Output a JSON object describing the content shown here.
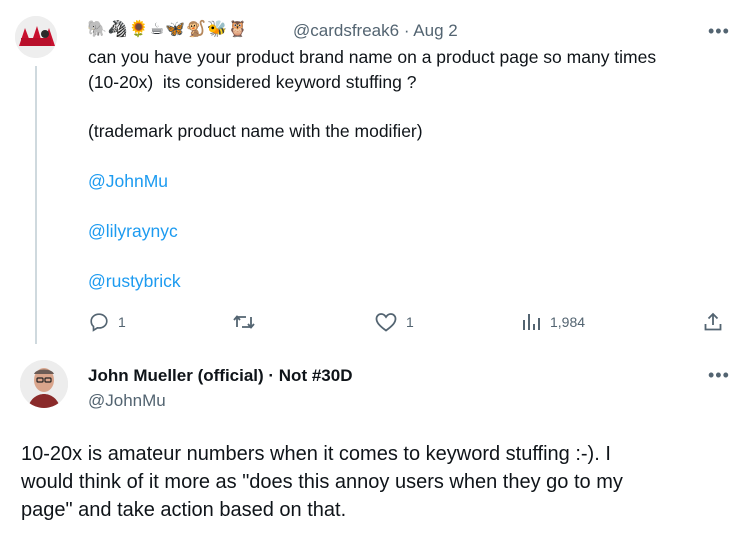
{
  "tweet1": {
    "emoji_names": [
      "elephant",
      "zebra",
      "sunflower",
      "coffee",
      "butterfly",
      "monkey",
      "bee",
      "owl"
    ],
    "handle": "@cardsfreak6",
    "separator": "·",
    "date": "Aug 2",
    "more": "•••",
    "lines": [
      "can you have your product brand name on a product page so many times",
      "(10-20x)  its considered keyword stuffing ?",
      "(trademark product name with the modifier)"
    ],
    "mentions": [
      "@JohnMu",
      "@lilyraynyc",
      "@rustybrick"
    ],
    "actions": {
      "reply_count": "1",
      "retweet_count": "",
      "like_count": "1",
      "views_count": "1,984"
    }
  },
  "tweet2": {
    "display_name": "John Mueller (official) · Not #30D",
    "handle": "@JohnMu",
    "more": "•••",
    "lines": [
      "10-20x is amateur numbers when it comes to keyword stuffing :-). I",
      "would think of it more as \"does this annoy users when they go to my",
      "page\" and take action based on that."
    ]
  },
  "colors": {
    "link": "#1d9bf0",
    "muted": "#536471",
    "text": "#0f1419",
    "thread_line": "#cfd9de"
  }
}
